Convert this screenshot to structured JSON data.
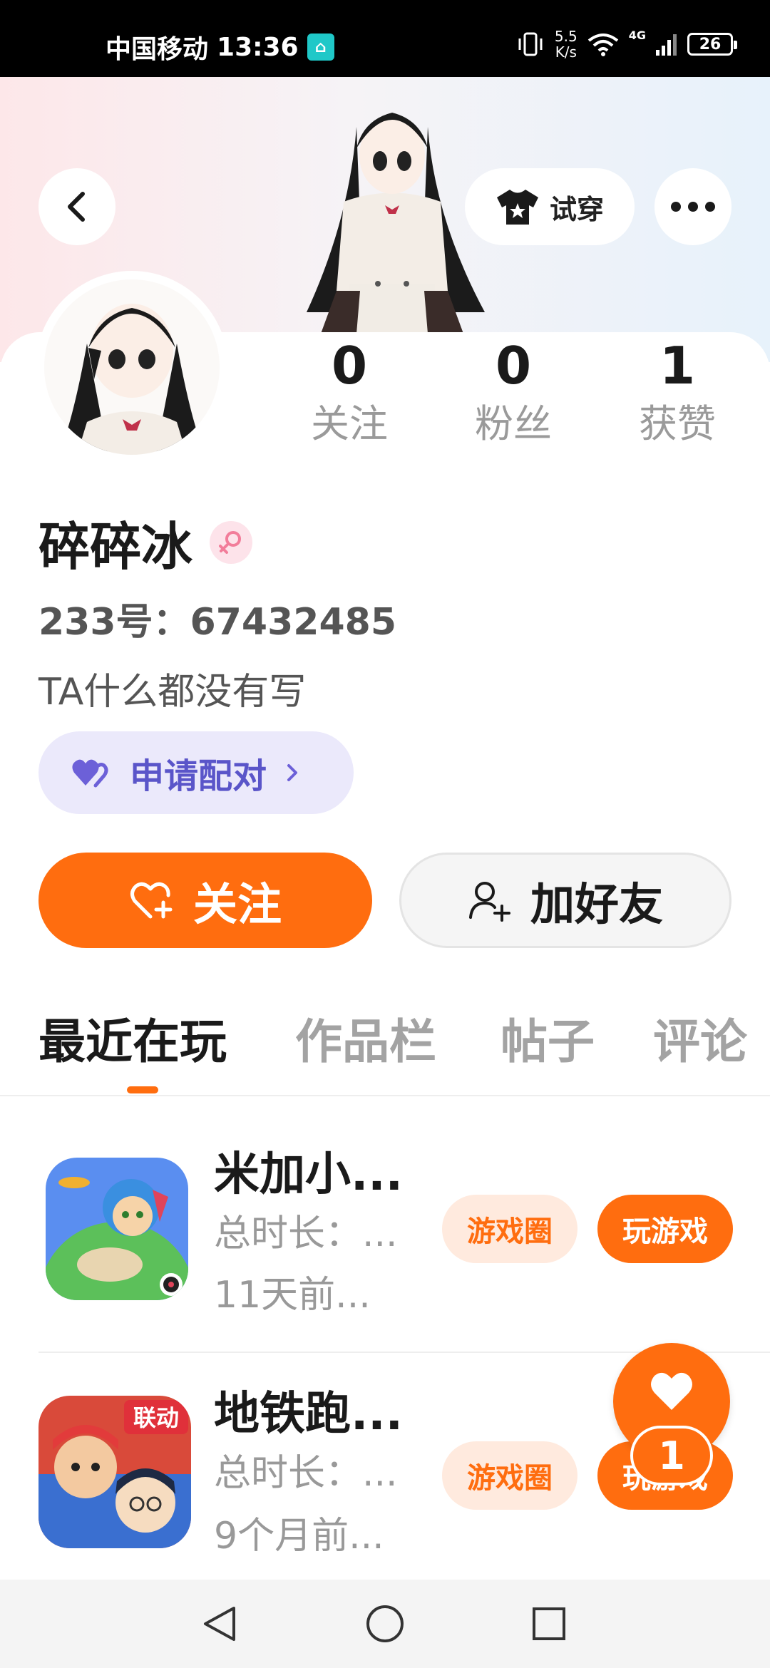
{
  "status_bar": {
    "carrier": "中国移动",
    "time": "13:36",
    "net_speed_value": "5.5",
    "net_speed_unit": "K/s",
    "network": "4G",
    "battery": "26"
  },
  "header": {
    "tryon_label": "试穿"
  },
  "profile": {
    "stats": [
      {
        "value": "0",
        "label": "关注"
      },
      {
        "value": "0",
        "label": "粉丝"
      },
      {
        "value": "1",
        "label": "获赞"
      }
    ],
    "username": "碎碎冰",
    "gender": "female",
    "uid_label": "233号：",
    "uid": "67432485",
    "bio": "TA什么都没有写",
    "pair_label": "申请配对",
    "follow_label": "关注",
    "add_friend_label": "加好友"
  },
  "tabs": [
    {
      "label": "最近在玩",
      "active": true
    },
    {
      "label": "作品栏",
      "active": false
    },
    {
      "label": "帖子",
      "active": false
    },
    {
      "label": "评论",
      "active": false
    }
  ],
  "games": [
    {
      "name": "米加小...",
      "playtime": "总时长：...",
      "last_played": "11天前...",
      "circle_label": "游戏圈",
      "play_label": "玩游戏"
    },
    {
      "name": "地铁跑...",
      "playtime": "总时长：...",
      "last_played": "9个月前...",
      "circle_label": "游戏圈",
      "play_label": "玩游戏",
      "icon_badge": "联动"
    }
  ],
  "fab": {
    "like_count": "1"
  },
  "colors": {
    "accent": "#ff6d0f",
    "pair_bg": "#ebe9fb",
    "pair_text": "#5a55c9",
    "muted_text": "#9a9a9a"
  },
  "icons": {
    "back": "chevron-left-icon",
    "tryon": "tshirt-star-icon",
    "more": "more-dots-icon",
    "gender": "female-icon",
    "pair": "double-heart-icon",
    "follow": "heart-plus-icon",
    "add_friend": "person-plus-icon",
    "fab": "heart-icon"
  }
}
